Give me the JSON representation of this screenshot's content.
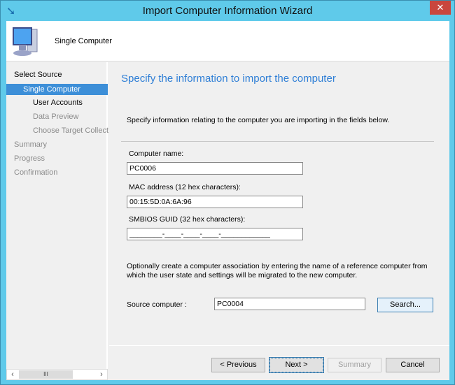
{
  "window": {
    "title": "Import Computer Information Wizard",
    "close": "✕"
  },
  "header": {
    "label": "Single Computer"
  },
  "nav": {
    "items": [
      {
        "label": "Select Source"
      },
      {
        "label": "Single Computer"
      },
      {
        "label": "User Accounts"
      },
      {
        "label": "Data Preview"
      },
      {
        "label": "Choose Target Collect"
      },
      {
        "label": "Summary"
      },
      {
        "label": "Progress"
      },
      {
        "label": "Confirmation"
      }
    ]
  },
  "main": {
    "heading": "Specify the information to import the computer",
    "intro": "Specify information relating to the computer you are importing in the fields below.",
    "computer_name_label": "Computer name:",
    "computer_name": "PC0006",
    "mac_label": "MAC address (12 hex characters):",
    "mac": "00:15:5D:0A:6A:96",
    "guid_label": "SMBIOS GUID (32 hex characters):",
    "guid": "________-____-____-____-____________",
    "assoc_text": "Optionally create a computer association by entering the name of a reference computer from which the user state and settings will be migrated to the new computer.",
    "source_label": "Source computer :",
    "source": "PC0004",
    "search": "Search..."
  },
  "buttons": {
    "previous": "< Previous",
    "next": "Next >",
    "summary": "Summary",
    "cancel": "Cancel"
  }
}
